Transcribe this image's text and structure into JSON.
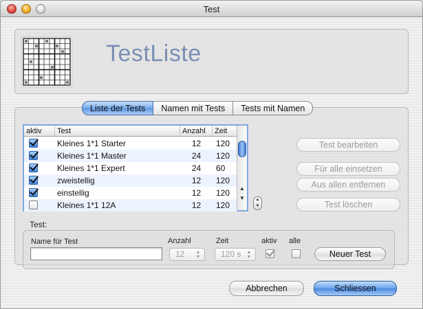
{
  "window": {
    "title": "Test"
  },
  "header": {
    "title": "TestListe",
    "logo_icon": "sudoku-grid-icon"
  },
  "tabs": [
    {
      "label": "Liste der Tests",
      "active": true
    },
    {
      "label": "Namen mit Tests",
      "active": false
    },
    {
      "label": "Tests mit Namen",
      "active": false
    }
  ],
  "table": {
    "columns": [
      "aktiv",
      "Test",
      "Anzahl",
      "Zeit"
    ],
    "rows": [
      {
        "aktiv": true,
        "test": "Kleines 1*1 Starter",
        "anzahl": "12",
        "zeit": "120"
      },
      {
        "aktiv": true,
        "test": "Kleines 1*1 Master",
        "anzahl": "24",
        "zeit": "120"
      },
      {
        "aktiv": true,
        "test": "Kleines 1*1 Expert",
        "anzahl": "24",
        "zeit": "60"
      },
      {
        "aktiv": true,
        "test": "zweistellig",
        "anzahl": "12",
        "zeit": "120"
      },
      {
        "aktiv": true,
        "test": "einstellig",
        "anzahl": "12",
        "zeit": "120"
      },
      {
        "aktiv": false,
        "test": "Kleines 1*1 12A",
        "anzahl": "12",
        "zeit": "120"
      }
    ]
  },
  "side_buttons": {
    "edit": "Test bearbeiten",
    "apply_all": "Für alle einsetzen",
    "remove_all": "Aus allen entfernen",
    "delete": "Test löschen"
  },
  "form": {
    "section_label": "Test:",
    "name_label": "Name für Test",
    "name_value": "",
    "anzahl_label": "Anzahl",
    "anzahl_value": "12",
    "zeit_label": "Zeit",
    "zeit_value": "120 s",
    "aktiv_label": "aktiv",
    "aktiv_checked": true,
    "alle_label": "alle",
    "alle_checked": false,
    "new_button": "Neuer Test"
  },
  "footer": {
    "cancel": "Abbrechen",
    "close": "Schliessen"
  },
  "colors": {
    "accent": "#5f98e2",
    "title_text": "#7b8fb4"
  }
}
